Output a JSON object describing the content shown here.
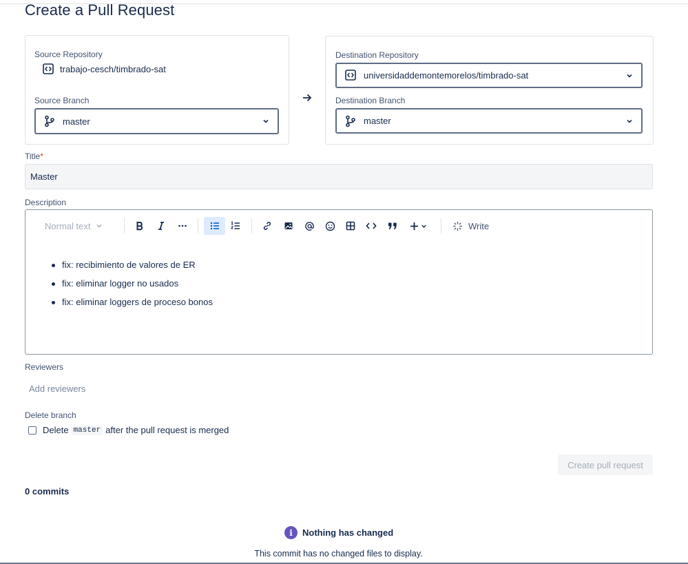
{
  "page": {
    "title": "Create a Pull Request"
  },
  "source": {
    "repo_label": "Source Repository",
    "repo_value": "trabajo-cesch/timbrado-sat",
    "branch_label": "Source Branch",
    "branch_value": "master"
  },
  "destination": {
    "repo_label": "Destination Repository",
    "repo_value": "universidaddemontemorelos/timbrado-sat",
    "branch_label": "Destination Branch",
    "branch_value": "master"
  },
  "title_field": {
    "label": "Title",
    "required_mark": "*",
    "value": "Master"
  },
  "description": {
    "label": "Description",
    "toolbar": {
      "text_style": "Normal text",
      "write_label": "Write",
      "icons": [
        "bold-icon",
        "italic-icon",
        "more-icon",
        "bullet-list-icon",
        "numbered-list-icon",
        "link-icon",
        "image-icon",
        "mention-icon",
        "emoji-icon",
        "table-icon",
        "code-icon",
        "quote-icon",
        "insert-icon"
      ]
    },
    "items": [
      "fix: recibimiento de valores de ER",
      "fix: eliminar logger no usados",
      "fix: eliminar loggers de proceso bonos"
    ]
  },
  "reviewers": {
    "label": "Reviewers",
    "placeholder": "Add reviewers"
  },
  "delete_branch": {
    "label": "Delete branch",
    "text_before": "Delete",
    "branch": "master",
    "text_after": "after the pull request is merged",
    "checked": false
  },
  "actions": {
    "create_label": "Create pull request"
  },
  "commits": {
    "count_label": "0 commits",
    "empty_title": "Nothing has changed",
    "empty_message": "This commit has no changed files to display."
  },
  "colors": {
    "accent": "#0052cc",
    "info": "#6554c0",
    "active_bg": "#deebff"
  }
}
